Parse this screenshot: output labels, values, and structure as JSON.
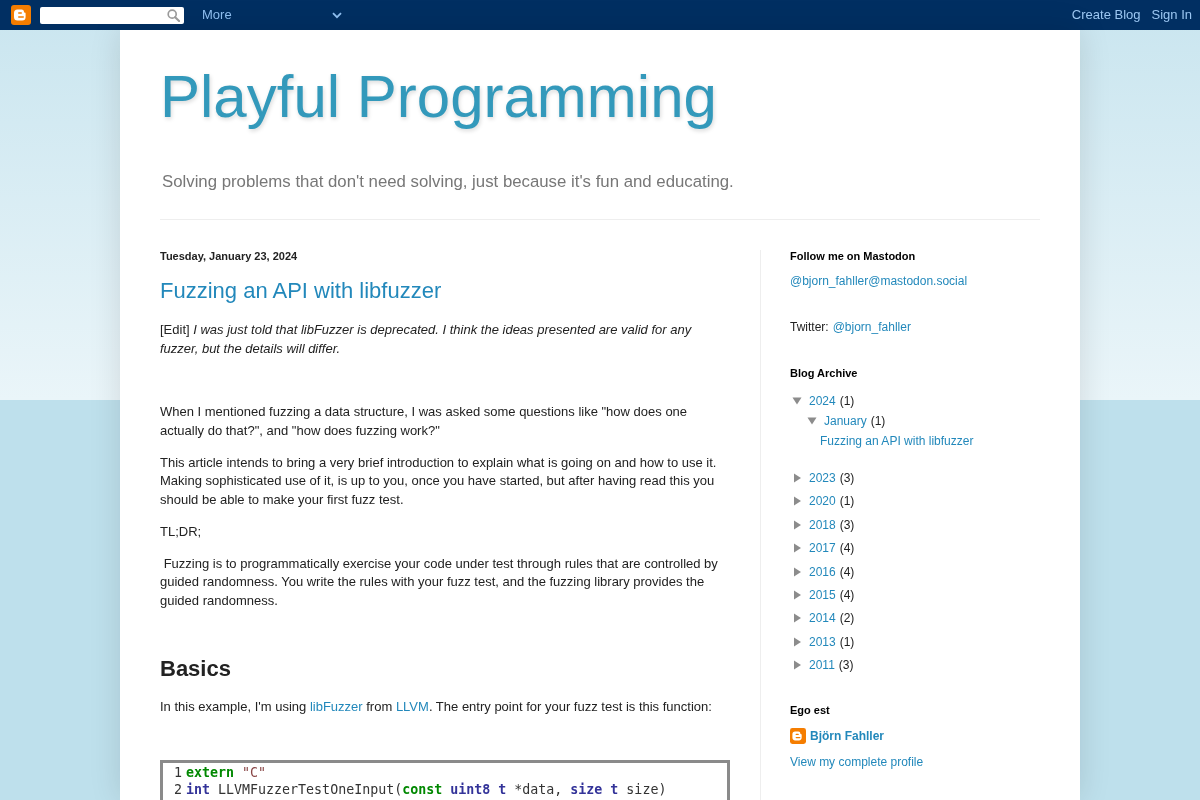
{
  "navbar": {
    "more_label": "More",
    "links": [
      "Create Blog",
      "Sign In"
    ]
  },
  "header": {
    "title": "Playful Programming",
    "description": "Solving problems that don't need solving, just because it's fun and educating."
  },
  "post": {
    "date": "Tuesday, January 23, 2024",
    "title": "Fuzzing an API with libfuzzer",
    "blocks": [
      {
        "kind": "note",
        "text": "[Edit] *I was just told that libFuzzer is deprecated. I think the ideas presented are valid for any fuzzer, but the details will differ.*"
      },
      {
        "kind": "paragraph",
        "text": "When I mentioned fuzzing a data structure, I was asked some questions like \"how does one actually do that?\", and \"how does fuzzing work?\""
      },
      {
        "kind": "paragraph",
        "text": "This article intends to bring a very brief introduction to explain what is going on and how to use it. Making sophisticated use of it, is up to you, once you have started, but after having read this you should be able to make your first fuzz test."
      },
      {
        "kind": "paragraph",
        "text": "TL;DR;"
      },
      {
        "kind": "paragraph",
        "text": " Fuzzing is to programmatically exercise your code under test through rules that are controlled by guided randomness. You write the rules with your fuzz test, and the fuzzing library provides the guided randomness."
      },
      {
        "kind": "heading",
        "text": "Basics"
      },
      {
        "kind": "linked_paragraph",
        "segments": [
          {
            "kind": "text",
            "text": "In this example, I'm using "
          },
          {
            "kind": "link",
            "text": "libFuzzer"
          },
          {
            "kind": "text",
            "text": " from "
          },
          {
            "kind": "link",
            "text": "LLVM"
          },
          {
            "kind": "text",
            "text": ". The entry point for your fuzz test is this function:"
          }
        ]
      },
      {
        "kind": "code",
        "lines": [
          {
            "number": "1",
            "tokens": [
              {
                "kind": "keyword",
                "text": "extern"
              },
              {
                "kind": "string",
                "text": " \"C\""
              }
            ]
          },
          {
            "number": "2",
            "tokens": [
              {
                "kind": "type",
                "text": "int"
              },
              {
                "kind": "plain",
                "text": " LLVMFuzzerTestOneInput("
              },
              {
                "kind": "keyword",
                "text": "const"
              },
              {
                "kind": "type",
                "text": " uint8 t"
              },
              {
                "kind": "plain",
                "text": " *data, "
              },
              {
                "kind": "type",
                "text": "size t"
              },
              {
                "kind": "plain",
                "text": " size)"
              }
            ]
          }
        ]
      }
    ]
  },
  "sidebar": [
    {
      "kind": "links",
      "title": "Follow me on Mastodon",
      "lines": [
        {
          "link": "@bjorn_fahller@mastodon.social"
        },
        {
          "label": "Twitter:",
          "link": "@bjorn_fahller"
        }
      ]
    },
    {
      "kind": "archive",
      "title": "Blog Archive",
      "items": [
        {
          "kind": "period",
          "label": "2024",
          "count": "(1)",
          "expanded": true,
          "children": [
            {
              "kind": "period",
              "label": "January",
              "count": "(1)",
              "expanded": true,
              "children": [
                {
                  "kind": "post",
                  "label": "Fuzzing an API with libfuzzer"
                }
              ]
            }
          ]
        },
        {
          "kind": "period",
          "label": "2023",
          "count": "(3)",
          "expanded": false
        },
        {
          "kind": "period",
          "label": "2020",
          "count": "(1)",
          "expanded": false
        },
        {
          "kind": "period",
          "label": "2018",
          "count": "(3)",
          "expanded": false
        },
        {
          "kind": "period",
          "label": "2017",
          "count": "(4)",
          "expanded": false
        },
        {
          "kind": "period",
          "label": "2016",
          "count": "(4)",
          "expanded": false
        },
        {
          "kind": "period",
          "label": "2015",
          "count": "(4)",
          "expanded": false
        },
        {
          "kind": "period",
          "label": "2014",
          "count": "(2)",
          "expanded": false
        },
        {
          "kind": "period",
          "label": "2013",
          "count": "(1)",
          "expanded": false
        },
        {
          "kind": "period",
          "label": "2011",
          "count": "(3)",
          "expanded": false
        }
      ]
    },
    {
      "kind": "profile",
      "title": "Ego est",
      "name": "Björn Fahller",
      "profile_link": "View my complete profile"
    }
  ]
}
